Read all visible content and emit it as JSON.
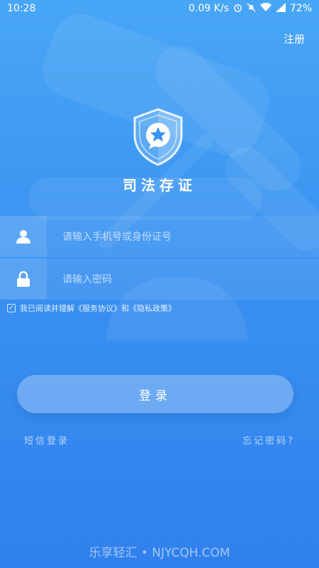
{
  "status_bar": {
    "time": "10:28",
    "speed": "0.09 K/s",
    "battery": "72%",
    "icons": [
      "alarm-icon",
      "mute-icon",
      "wifi-icon",
      "signal-icon",
      "battery-icon"
    ]
  },
  "header": {
    "register_label": "注册"
  },
  "brand": {
    "title": "司法存证",
    "logo_icon": "shield-star-icon"
  },
  "form": {
    "account_placeholder": "请输入手机号或身份证号",
    "password_placeholder": "请输入密码",
    "agreement_text": "我已阅读并理解《服务协议》和《隐私政策》",
    "agreement_checked": true
  },
  "actions": {
    "login_label": "登录",
    "sms_login_label": "短信登录",
    "forgot_label": "忘记密码?"
  },
  "watermark": "乐享轻汇 • NJYCQH.COM",
  "colors": {
    "background_top": "#48a6f6",
    "background_bottom": "#2f80ec",
    "text": "#ffffff"
  }
}
